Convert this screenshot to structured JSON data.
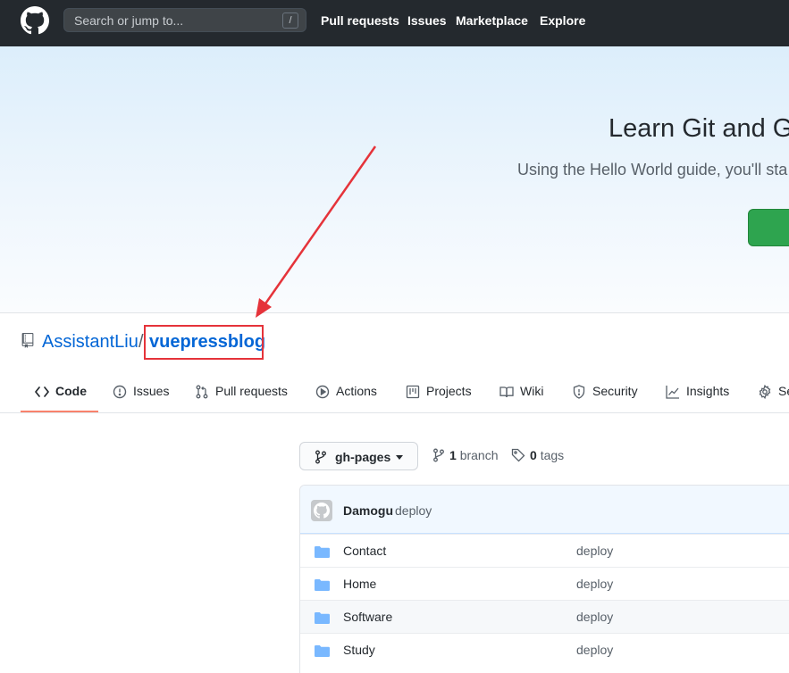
{
  "header": {
    "search_placeholder": "Search or jump to...",
    "search_shortcut": "/",
    "nav": [
      "Pull requests",
      "Issues",
      "Marketplace",
      "Explore"
    ]
  },
  "banner": {
    "title": "Learn Git and G",
    "subtitle": "Using the Hello World guide, you'll sta"
  },
  "repo": {
    "owner": "AssistantLiu",
    "separator": "/",
    "name": "vuepressblog"
  },
  "tabs": [
    {
      "label": "Code",
      "icon": "code-icon"
    },
    {
      "label": "Issues",
      "icon": "issue-opened-icon"
    },
    {
      "label": "Pull requests",
      "icon": "git-pull-request-icon"
    },
    {
      "label": "Actions",
      "icon": "play-icon"
    },
    {
      "label": "Projects",
      "icon": "project-icon"
    },
    {
      "label": "Wiki",
      "icon": "book-icon"
    },
    {
      "label": "Security",
      "icon": "shield-icon"
    },
    {
      "label": "Insights",
      "icon": "graph-icon"
    },
    {
      "label": "Se",
      "icon": "gear-icon"
    }
  ],
  "branch": {
    "current": "gh-pages",
    "branch_count": "1",
    "branch_word": "branch",
    "tag_count": "0",
    "tag_word": "tags"
  },
  "commit": {
    "author": "Damogu",
    "message": "deploy"
  },
  "files": [
    {
      "name": "Contact",
      "message": "deploy"
    },
    {
      "name": "Home",
      "message": "deploy"
    },
    {
      "name": "Software",
      "message": "deploy"
    },
    {
      "name": "Study",
      "message": "deploy"
    }
  ],
  "colors": {
    "header_bg": "#24292e",
    "link": "#0366d6",
    "annotation_red": "#e5333a",
    "selected_tab_underline": "#f9826c",
    "banner_button": "#2ea44f",
    "folder": "#79b8ff"
  }
}
